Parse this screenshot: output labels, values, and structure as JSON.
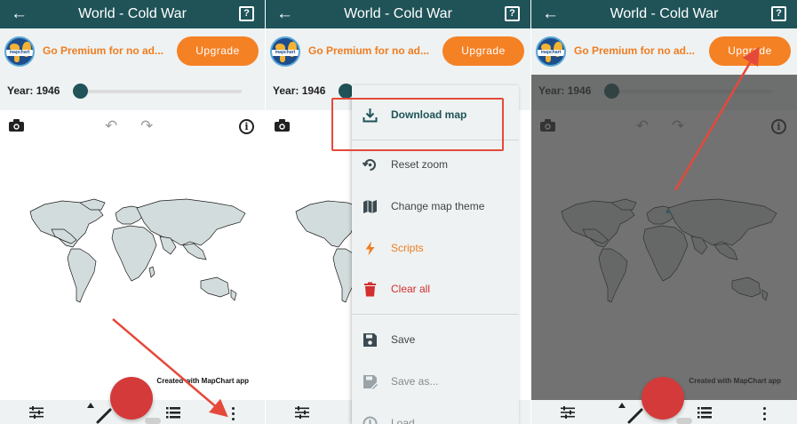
{
  "app": {
    "title": "World - Cold War",
    "back_icon": "arrow-left-icon",
    "help_icon": "help-box-icon"
  },
  "promo": {
    "logo_text": "mapchart",
    "text": "Go Premium for no ad...",
    "upgrade_label": "Upgrade"
  },
  "year": {
    "label": "Year: 1946",
    "slider_fraction": 0.0
  },
  "map": {
    "credit": "Created with MapChart app",
    "colors": {
      "land": "#d3dcdc",
      "border": "#1a1a1a",
      "highlight": "#3aa0c8"
    }
  },
  "menu": {
    "items": [
      {
        "label": "Download map",
        "icon": "download-icon",
        "color": "#1f5358",
        "bold": true
      },
      {
        "label": "Reset zoom",
        "icon": "reset-zoom-icon",
        "color": "#444444"
      },
      {
        "label": "Change map theme",
        "icon": "map-icon",
        "color": "#444444"
      },
      {
        "label": "Scripts",
        "icon": "lightning-icon",
        "color": "#ef7d22"
      },
      {
        "label": "Clear all",
        "icon": "trash-icon",
        "color": "#d32f2f"
      },
      {
        "label": "Save",
        "icon": "save-icon",
        "color": "#444444"
      },
      {
        "label": "Save as...",
        "icon": "save-edit-icon",
        "color": "#9a9a9a"
      },
      {
        "label": "Load...",
        "icon": "history-icon",
        "color": "#9a9a9a"
      }
    ]
  },
  "colors": {
    "topbar": "#1f5358",
    "accent": "#f58125",
    "fab": "#d43a3a",
    "annotation": "#e5493a"
  }
}
